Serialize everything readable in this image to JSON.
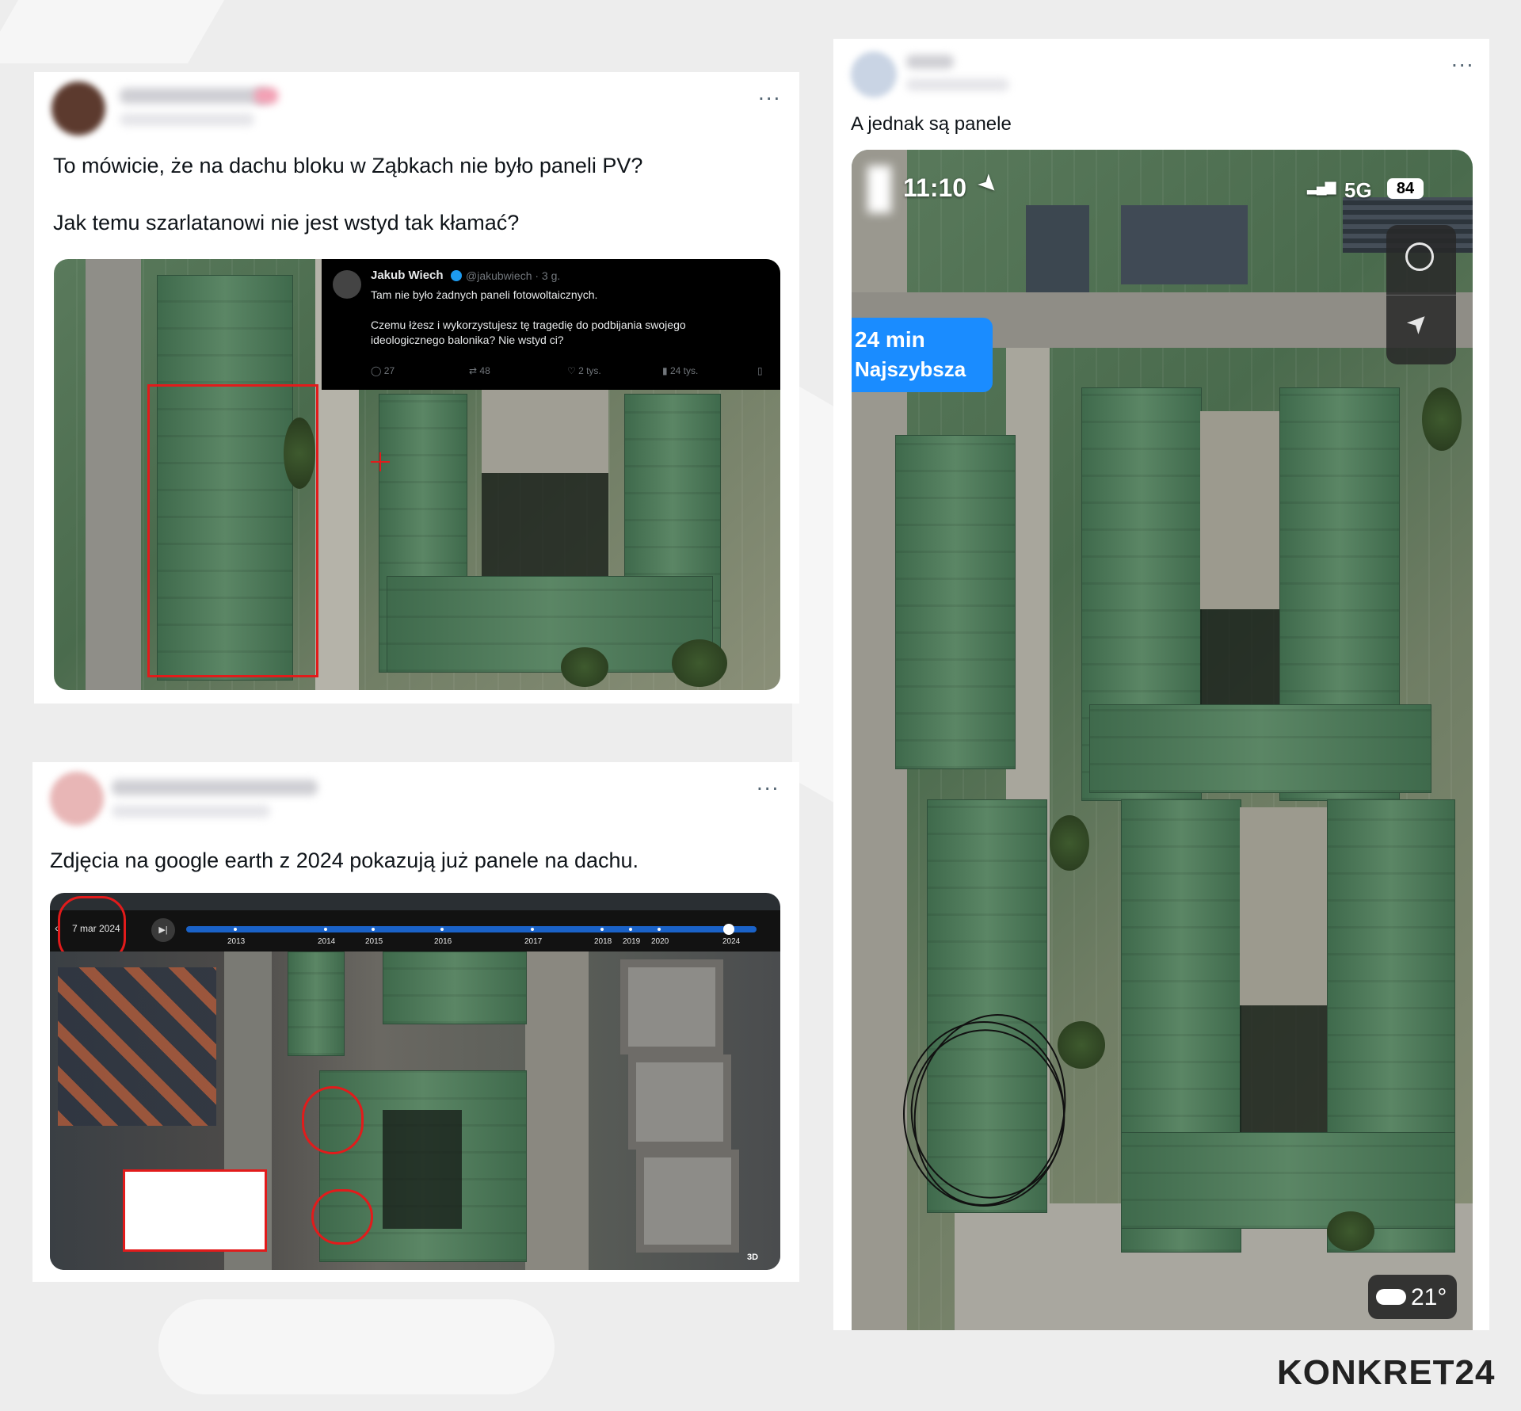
{
  "post1": {
    "text": "To mówicie, że na dachu bloku w Ząbkach nie było paneli PV?\n\nJak temu szarlatanowi nie jest wstyd tak kłamać?",
    "more_label": "...",
    "embed": {
      "name": "Jakub Wiech",
      "handle": "@jakubwiech · 3 g.",
      "text": "Tam nie było żadnych paneli fotowoltaicznych.\n\nCzemu łżesz i wykorzystujesz tę tragedię do podbijania swojego ideologicznego balonika? Nie wstyd ci?",
      "replies": "27",
      "reposts": "48",
      "likes": "2 tys.",
      "views": "24 tys."
    }
  },
  "post2": {
    "text": "Zdjęcia na google earth z 2024 pokazują już panele na dachu.",
    "more_label": "...",
    "timeline": {
      "date": "7 mar 2024",
      "years": [
        "2013",
        "2014",
        "2015",
        "2016",
        "2017",
        "2018",
        "2019",
        "2020",
        "2024"
      ],
      "view_3d": "3D"
    }
  },
  "post3": {
    "text": "A jednak są panele",
    "more_label": "...",
    "phone": {
      "time": "11:10",
      "network": "5G",
      "battery": "84",
      "route_time": "24 min",
      "route_label": "Najszybsza",
      "temperature": "21°"
    }
  },
  "brand": {
    "logo": "KONKRET24"
  },
  "colors": {
    "accent_red": "#e21b1b",
    "maps_blue": "#1a8cff"
  }
}
